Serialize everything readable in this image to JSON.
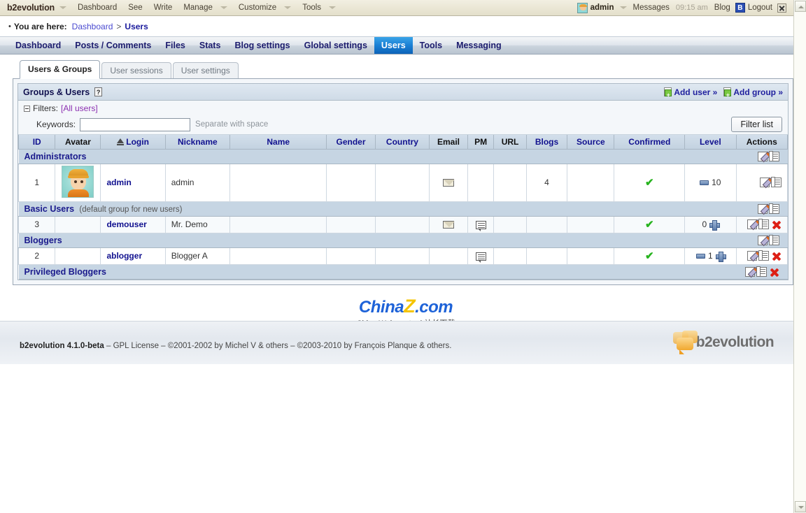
{
  "evobar": {
    "brand": "b2evolution",
    "left_items": [
      {
        "label": "Dashboard",
        "caret": false
      },
      {
        "label": "See",
        "caret": false
      },
      {
        "label": "Write",
        "caret": false
      },
      {
        "label": "Manage",
        "caret": true
      },
      {
        "label": "Customize",
        "caret": true
      },
      {
        "label": "Tools",
        "caret": true
      }
    ],
    "user": "admin",
    "messages": "Messages",
    "time": "09:15 am",
    "blog": "Blog",
    "blog_icon_letter": "B",
    "logout": "Logout"
  },
  "breadcrumb": {
    "bullet": "•",
    "prefix": "You are here:",
    "root": "Dashboard",
    "separator": ">",
    "current": "Users"
  },
  "mainmenu": {
    "items": [
      {
        "label": "Dashboard",
        "selected": false
      },
      {
        "label": "Posts / Comments",
        "selected": false
      },
      {
        "label": "Files",
        "selected": false
      },
      {
        "label": "Stats",
        "selected": false
      },
      {
        "label": "Blog settings",
        "selected": false
      },
      {
        "label": "Global settings",
        "selected": false
      },
      {
        "label": "Users",
        "selected": true
      },
      {
        "label": "Tools",
        "selected": false
      },
      {
        "label": "Messaging",
        "selected": false
      }
    ]
  },
  "tabs": [
    {
      "label": "Users & Groups",
      "active": true
    },
    {
      "label": "User sessions",
      "active": false
    },
    {
      "label": "User settings",
      "active": false
    }
  ],
  "panel": {
    "title": "Groups & Users",
    "help_glyph": "?",
    "add_user": "Add user »",
    "add_group": "Add group »"
  },
  "filters": {
    "label": "Filters:",
    "preset": "[All users]",
    "keywords_label": "Keywords:",
    "keywords_value": "",
    "keywords_placeholder": "",
    "hint": "Separate with space",
    "filter_button": "Filter list"
  },
  "table": {
    "columns": [
      {
        "label": "ID",
        "link": true,
        "sorted": false
      },
      {
        "label": "Avatar",
        "link": false,
        "sorted": false
      },
      {
        "label": "Login",
        "link": true,
        "sorted": true
      },
      {
        "label": "Nickname",
        "link": true,
        "sorted": false
      },
      {
        "label": "Name",
        "link": true,
        "sorted": false
      },
      {
        "label": "Gender",
        "link": true,
        "sorted": false
      },
      {
        "label": "Country",
        "link": true,
        "sorted": false
      },
      {
        "label": "Email",
        "link": false,
        "sorted": false
      },
      {
        "label": "PM",
        "link": false,
        "sorted": false
      },
      {
        "label": "URL",
        "link": false,
        "sorted": false
      },
      {
        "label": "Blogs",
        "link": true,
        "sorted": false
      },
      {
        "label": "Source",
        "link": true,
        "sorted": false
      },
      {
        "label": "Confirmed",
        "link": true,
        "sorted": false
      },
      {
        "label": "Level",
        "link": true,
        "sorted": false
      },
      {
        "label": "Actions",
        "link": false,
        "sorted": false
      }
    ],
    "groups": [
      {
        "name": "Administrators",
        "note": "",
        "actions": [
          "edit-icon",
          "copy-icon"
        ],
        "users": [
          {
            "id": "1",
            "avatar": "admin-avatar",
            "login": "admin",
            "nickname": "admin",
            "name": "",
            "gender": "",
            "country": "",
            "email": "envelope-icon",
            "pm": "",
            "url": "",
            "blogs": "4",
            "source": "",
            "confirmed": "✔",
            "level": "10",
            "level_minus": true,
            "level_plus": false,
            "actions": [
              "edit-icon",
              "copy-icon"
            ]
          }
        ]
      },
      {
        "name": "Basic Users",
        "note": "(default group for new users)",
        "actions": [
          "edit-icon",
          "copy-icon"
        ],
        "users": [
          {
            "id": "3",
            "avatar": "",
            "login": "demouser",
            "nickname": "Mr. Demo",
            "name": "",
            "gender": "",
            "country": "",
            "email": "envelope-icon",
            "pm": "pm-icon",
            "url": "",
            "blogs": "",
            "source": "",
            "confirmed": "✔",
            "level": "0",
            "level_minus": false,
            "level_plus": true,
            "actions": [
              "edit-icon",
              "copy-icon",
              "delete-icon"
            ]
          }
        ]
      },
      {
        "name": "Bloggers",
        "note": "",
        "actions": [
          "edit-icon",
          "copy-icon"
        ],
        "users": [
          {
            "id": "2",
            "avatar": "",
            "login": "ablogger",
            "nickname": "Blogger A",
            "name": "",
            "gender": "",
            "country": "",
            "email": "",
            "pm": "pm-icon",
            "url": "",
            "blogs": "",
            "source": "",
            "confirmed": "✔",
            "level": "1",
            "level_minus": true,
            "level_plus": true,
            "actions": [
              "edit-icon",
              "copy-icon",
              "delete-icon"
            ]
          }
        ]
      },
      {
        "name": "Privileged Bloggers",
        "note": "",
        "actions": [
          "edit-icon",
          "copy-icon",
          "delete-icon"
        ],
        "users": []
      }
    ]
  },
  "watermark": {
    "china": "China",
    "z": "Z",
    "com": ".com",
    "sub": "China Webmaster | 站长下载"
  },
  "footer": {
    "credit": "b2evolution 4.1.0-beta – GPL License – ©2001-2002 by Michel V & others – ©2003-2010 by François Planque & others.",
    "credit_bold": "b2evolution 4.1.0-beta",
    "logo_text": "b2evolution"
  }
}
